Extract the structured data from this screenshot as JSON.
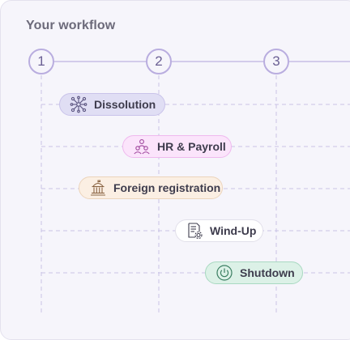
{
  "workflow": {
    "title": "Your workflow",
    "steps": [
      {
        "label": "1"
      },
      {
        "label": "2"
      },
      {
        "label": "3"
      }
    ],
    "tasks": [
      {
        "label": "Dissolution",
        "icon": "network-icon",
        "bg": "#e0def4",
        "border": "#c9c3ea"
      },
      {
        "label": "HR & Payroll",
        "icon": "people-icon",
        "bg": "#fbe4fb",
        "border": "#efb9ee"
      },
      {
        "label": "Foreign registration",
        "icon": "government-building-icon",
        "bg": "#fbefe3",
        "border": "#ecd4bb"
      },
      {
        "label": "Wind-Up",
        "icon": "document-gear-icon",
        "bg": "#ffffff",
        "border": "#e2e0ea"
      },
      {
        "label": "Shutdown",
        "icon": "power-icon",
        "bg": "#dcf1e7",
        "border": "#a9d9c1"
      }
    ]
  }
}
